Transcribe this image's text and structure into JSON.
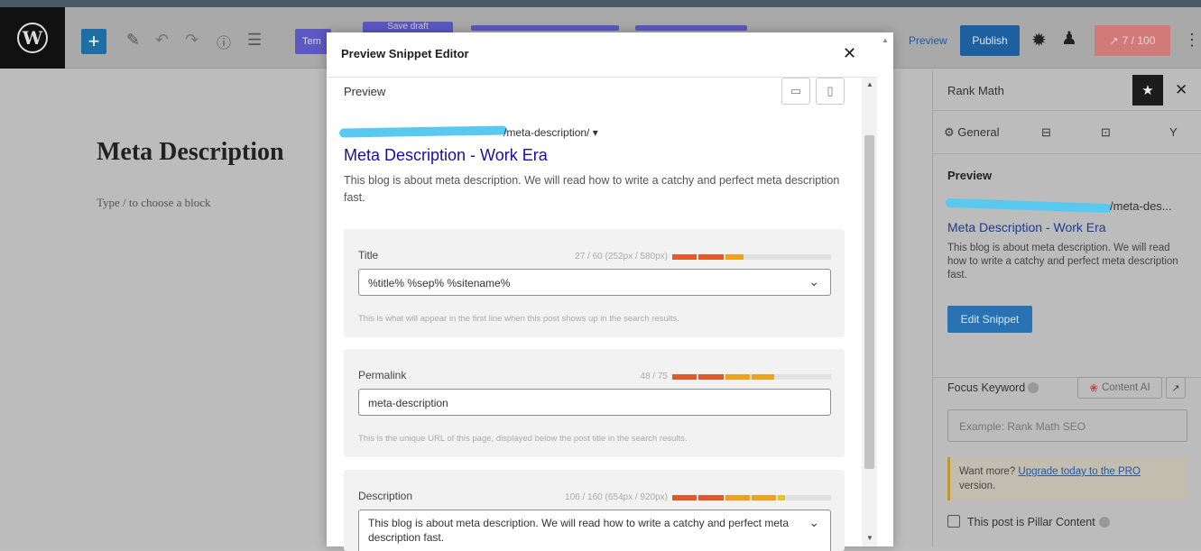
{
  "toolbar": {
    "template_label": "Tem",
    "ghost_label": "Save draft",
    "preview": "Preview",
    "publish": "Publish",
    "score": "7 / 100"
  },
  "editor": {
    "title": "Meta Description",
    "block_placeholder": "Type / to choose a block"
  },
  "sidebar": {
    "title": "Rank Math",
    "tabs": [
      {
        "label": "General"
      }
    ],
    "preview_heading": "Preview",
    "preview_url": "/meta-des...",
    "preview_title": "Meta Description - Work Era",
    "preview_desc": "This blog is about meta description. We will read how to write a catchy and perfect meta description fast.",
    "edit_snippet": "Edit Snippet",
    "focus_keyword": "Focus Keyword",
    "content_ai": "Content AI",
    "keyword_placeholder": "Example: Rank Math SEO",
    "pro_text": "Want more? ",
    "pro_link": "Upgrade today to the PRO",
    "pro_tail": " version.",
    "pillar": "This post is Pillar Content"
  },
  "modal": {
    "title": "Preview Snippet Editor",
    "preview_label": "Preview",
    "snippet_url": "/meta-description/ ▾",
    "snippet_title": "Meta Description - Work Era",
    "snippet_desc": "This blog is about meta description. We will read how to write a catchy and perfect meta description fast.",
    "fields": {
      "title": {
        "label": "Title",
        "counter": "27 / 60 (252px / 580px)",
        "fill": 0.45,
        "value": "%title% %sep% %sitename%",
        "help": "This is what will appear in the first line when this post shows up in the search results."
      },
      "permalink": {
        "label": "Permalink",
        "counter": "48 / 75",
        "fill": 0.64,
        "value": "meta-description",
        "help": "This is the unique URL of this page, displayed below the post title in the search results."
      },
      "description": {
        "label": "Description",
        "counter": "106 / 160 (654px / 920px)",
        "fill": 0.71,
        "value": "This blog is about meta description. We will read how to write a catchy and perfect meta description fast."
      }
    }
  },
  "colors": {
    "meter_red": "#e05b2b",
    "meter_orange": "#f0a11e",
    "meter_yellow": "#e6c526",
    "meter_green": "#a7c43a"
  }
}
